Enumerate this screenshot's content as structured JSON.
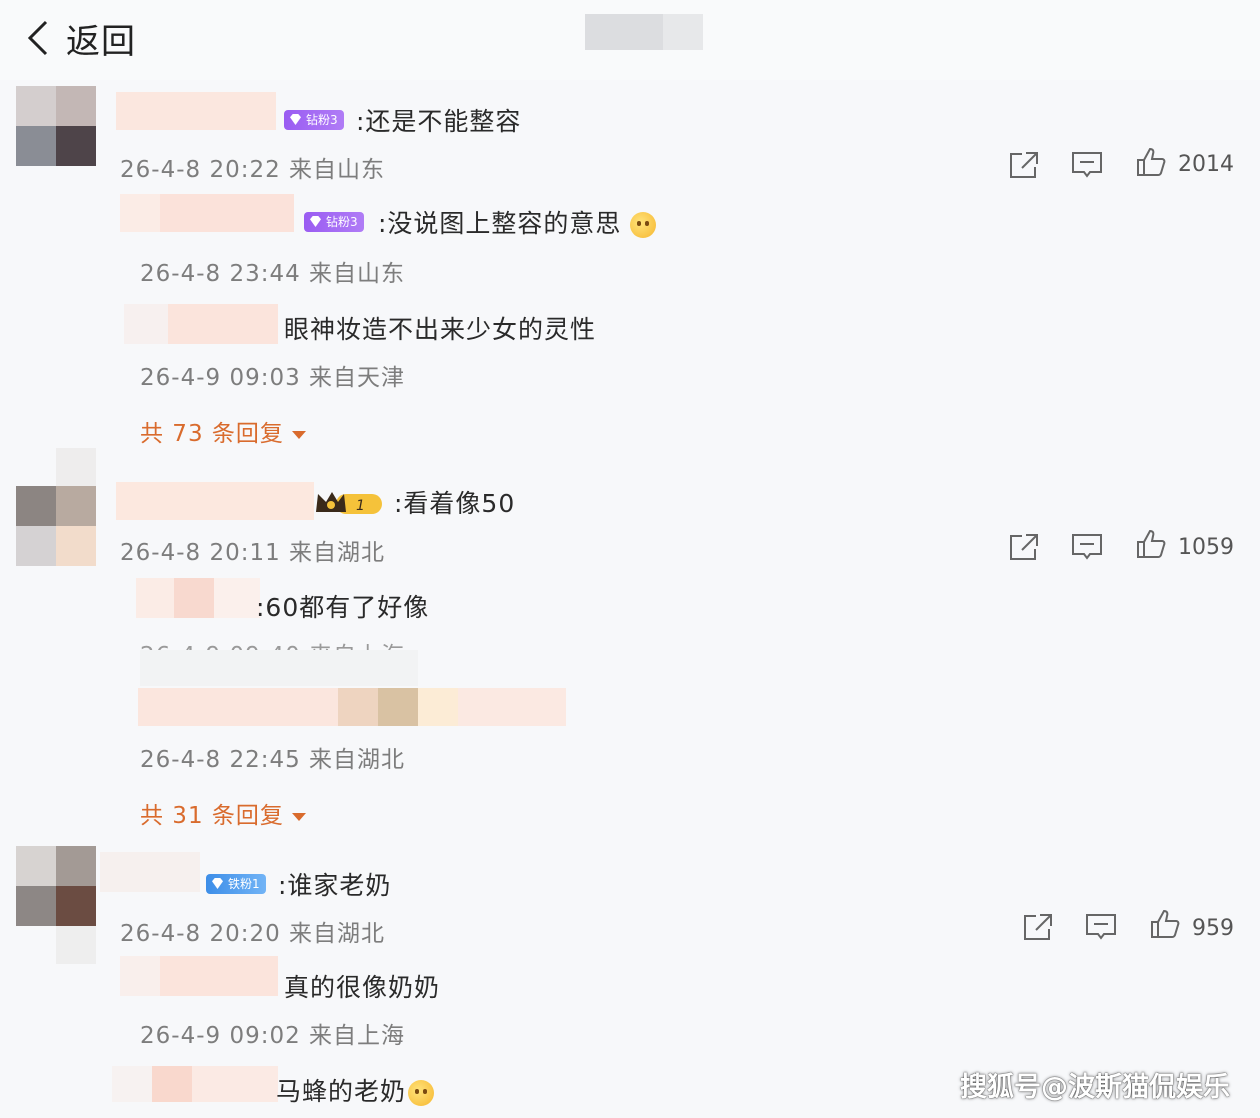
{
  "header": {
    "back_label": "返回"
  },
  "comments": [
    {
      "text": ":还是不能整容",
      "meta": "26-4-8 20:22 来自山东",
      "likes": "2014",
      "badge": "钻粉3",
      "replies": [
        {
          "text": ":没说图上整容的意思",
          "meta": "26-4-8 23:44 来自山东",
          "badge": "钻粉3"
        },
        {
          "text": "眼神妆造不出来少女的灵性",
          "meta": "26-4-9 09:03 来自天津"
        }
      ],
      "more": "共 73 条回复"
    },
    {
      "text": ":看着像50",
      "meta": "26-4-8 20:11 来自湖北",
      "likes": "1059",
      "badge": "1",
      "replies": [
        {
          "text": ":60都有了好像",
          "meta": ""
        },
        {
          "text": "",
          "meta": "26-4-8 22:45 来自湖北"
        }
      ],
      "more": "共 31 条回复"
    },
    {
      "text": ":谁家老奶",
      "meta": "26-4-8 20:20 来自湖北",
      "likes": "959",
      "badge": "铁粉1",
      "replies": [
        {
          "text": "真的很像奶奶",
          "meta": "26-4-9 09:02 来自上海"
        },
        {
          "text": "马蜂的老奶",
          "meta": ""
        }
      ]
    }
  ],
  "watermark": "搜狐号@波斯猫侃娱乐",
  "icons": [
    "chevron-left-icon",
    "share-icon",
    "comment-icon",
    "like-icon"
  ]
}
